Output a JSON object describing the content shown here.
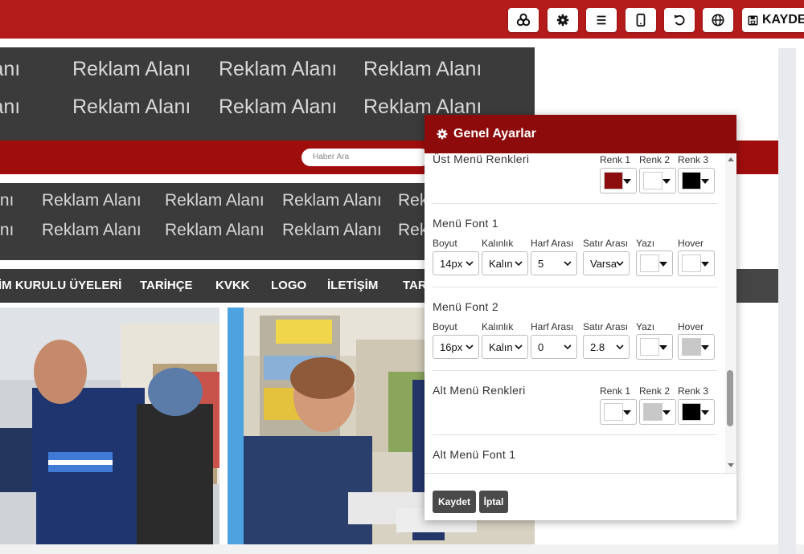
{
  "toolbar": {
    "save_label": "KAYDE",
    "icons": [
      "layers-icon",
      "gear-icon",
      "menu-icon",
      "mobile-icon",
      "undo-icon",
      "globe-icon",
      "floppy-icon"
    ]
  },
  "ads": {
    "label": "Reklam Alanı",
    "label_cut": "ılanı",
    "label_cut2": "ını",
    "label_cut3": "Rek"
  },
  "search": {
    "placeholder": "Haber Ara"
  },
  "nav": {
    "items": [
      "İM KURULU ÜYELERİ",
      "TARİHÇE",
      "KVKK",
      "LOGO",
      "İLETİŞİM",
      "TAR"
    ]
  },
  "modal": {
    "title": "Genel Ayarlar",
    "sections": {
      "ust_menu": {
        "title": "Üst Menü Renkleri",
        "colors": [
          {
            "label": "Renk 1",
            "value": "#8b0d0d"
          },
          {
            "label": "Renk 2",
            "value": "#ffffff"
          },
          {
            "label": "Renk 3",
            "value": "#000000"
          }
        ]
      },
      "menu_font_1": {
        "title": "Menü Font 1",
        "labels": {
          "size": "Boyut",
          "weight": "Kalınlık",
          "letter": "Harf Arası",
          "line": "Satır Arası",
          "text": "Yazı",
          "hover": "Hover"
        },
        "values": {
          "size": "14px",
          "weight": "Kalın",
          "letter": "5",
          "line": "Varsa"
        },
        "text_color": "#ffffff",
        "hover_color": "#ffffff"
      },
      "menu_font_2": {
        "title": "Menü Font 2",
        "labels": {
          "size": "Boyut",
          "weight": "Kalınlık",
          "letter": "Harf Arası",
          "line": "Satır Arası",
          "text": "Yazı",
          "hover": "Hover"
        },
        "values": {
          "size": "16px",
          "weight": "Kalın",
          "letter": "0",
          "line": "2.8"
        },
        "text_color": "#ffffff",
        "hover_color": "#c8c8c8"
      },
      "alt_menu": {
        "title": "Alt Menü Renkleri",
        "colors": [
          {
            "label": "Renk 1",
            "value": "#ffffff"
          },
          {
            "label": "Renk 2",
            "value": "#c8c8c8"
          },
          {
            "label": "Renk 3",
            "value": "#000000"
          }
        ]
      },
      "alt_menu_font": {
        "title": "Alt Menü Font 1"
      }
    },
    "buttons": {
      "save": "Kaydet",
      "cancel": "İptal"
    }
  },
  "colors": {
    "toolbar": "#b41b1b",
    "modal_header": "#8d0b0b",
    "ad_band": "#3b3b3b"
  }
}
